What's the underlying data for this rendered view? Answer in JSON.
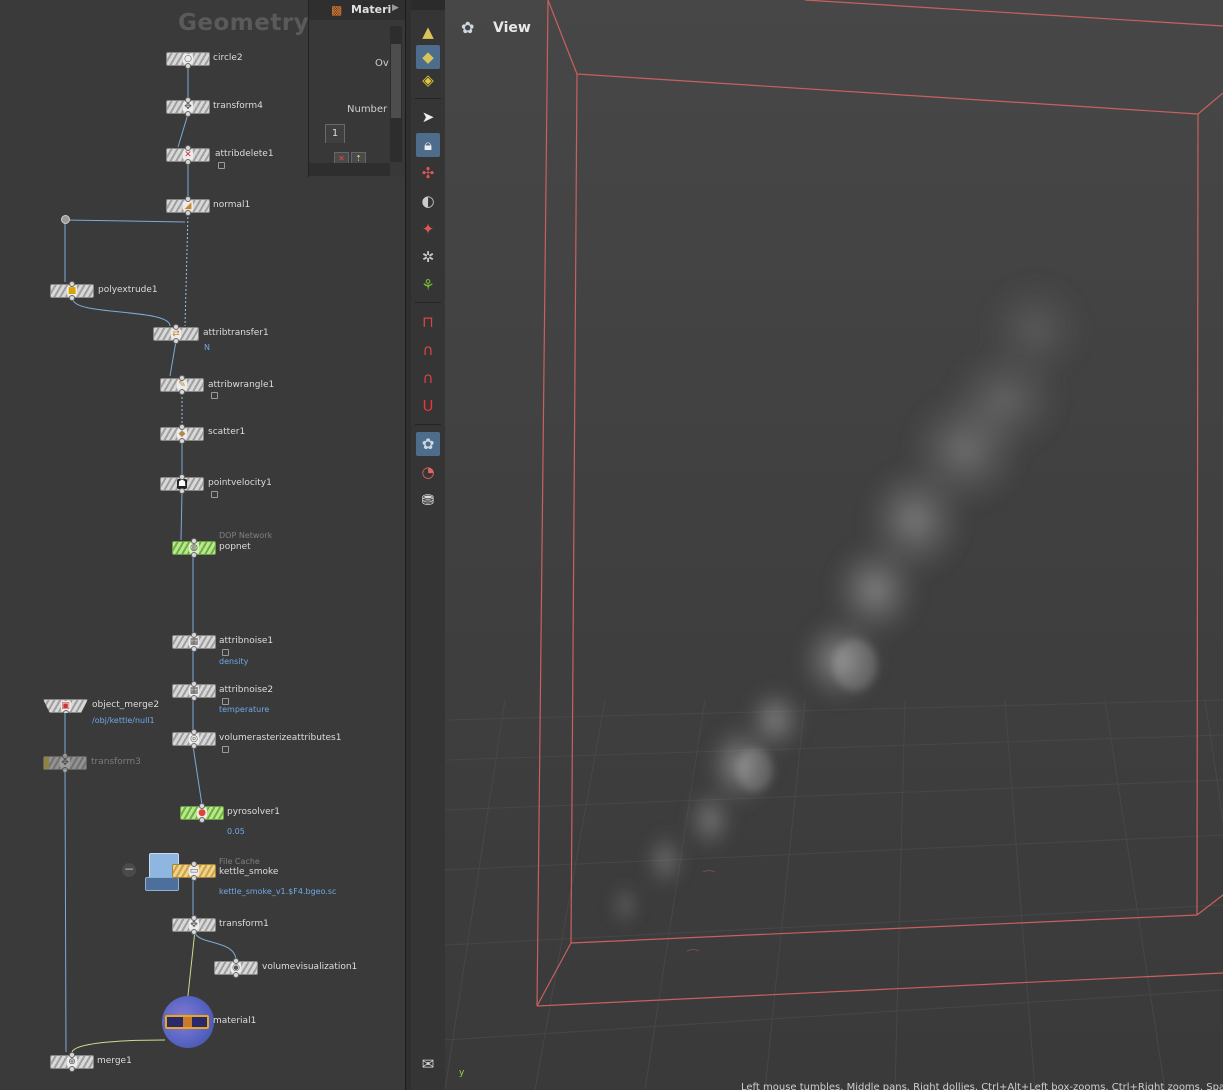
{
  "network": {
    "context_title": "Geometry",
    "nodes": {
      "circle2": {
        "name": "circle2"
      },
      "transform4": {
        "name": "transform4"
      },
      "attribdelete1": {
        "name": "attribdelete1"
      },
      "normal1": {
        "name": "normal1"
      },
      "polyextrude1": {
        "name": "polyextrude1"
      },
      "attribtransfer1": {
        "name": "attribtransfer1",
        "sub": "N"
      },
      "attribwrangle1": {
        "name": "attribwrangle1"
      },
      "scatter1": {
        "name": "scatter1"
      },
      "pointvelocity1": {
        "name": "pointvelocity1"
      },
      "popnet": {
        "name": "popnet",
        "type": "DOP Network"
      },
      "attribnoise1": {
        "name": "attribnoise1",
        "sub": "density"
      },
      "attribnoise2": {
        "name": "attribnoise2",
        "sub": "temperature"
      },
      "object_merge2": {
        "name": "object_merge2",
        "sub": "/obj/kettle/null1"
      },
      "transform3": {
        "name": "transform3"
      },
      "volumerasterizeattributes1": {
        "name": "volumerasterizeattributes1"
      },
      "pyrosolver1": {
        "name": "pyrosolver1",
        "sub": "0.05"
      },
      "kettle_smoke": {
        "name": "kettle_smoke",
        "type": "File Cache",
        "sub": "kettle_smoke_v1.$F4.bgeo.sc"
      },
      "transform1": {
        "name": "transform1"
      },
      "volumevisualization1": {
        "name": "volumevisualization1"
      },
      "material1": {
        "name": "material1"
      },
      "merge1": {
        "name": "merge1"
      }
    },
    "icons": {
      "collapse": "minus-icon"
    }
  },
  "params": {
    "tab_label": "Materi",
    "overflow_label": "Ov",
    "number_label": "Number",
    "multiparm_index": "1"
  },
  "toolbar": {
    "tools": [
      "select",
      "lock-select",
      "handle",
      "view",
      "light",
      "camera",
      "scatter",
      "snap-grid",
      "snap-prim",
      "snap-point",
      "snap-multi",
      "display-options",
      "display-flags",
      "render",
      "visibility"
    ]
  },
  "viewport": {
    "title": "View",
    "axis_label": "y",
    "status_text": "Left mouse tumbles. Middle pans. Right dollies. Ctrl+Alt+Left box-zooms. Ctrl+Right zooms. Space"
  },
  "colors": {
    "network_bg": "#3a3a3a",
    "viewport_bg": "#474747",
    "bbox_edge": "#c86060",
    "wire": "#7fa9d6",
    "active_tool": "#4e6d8c"
  }
}
